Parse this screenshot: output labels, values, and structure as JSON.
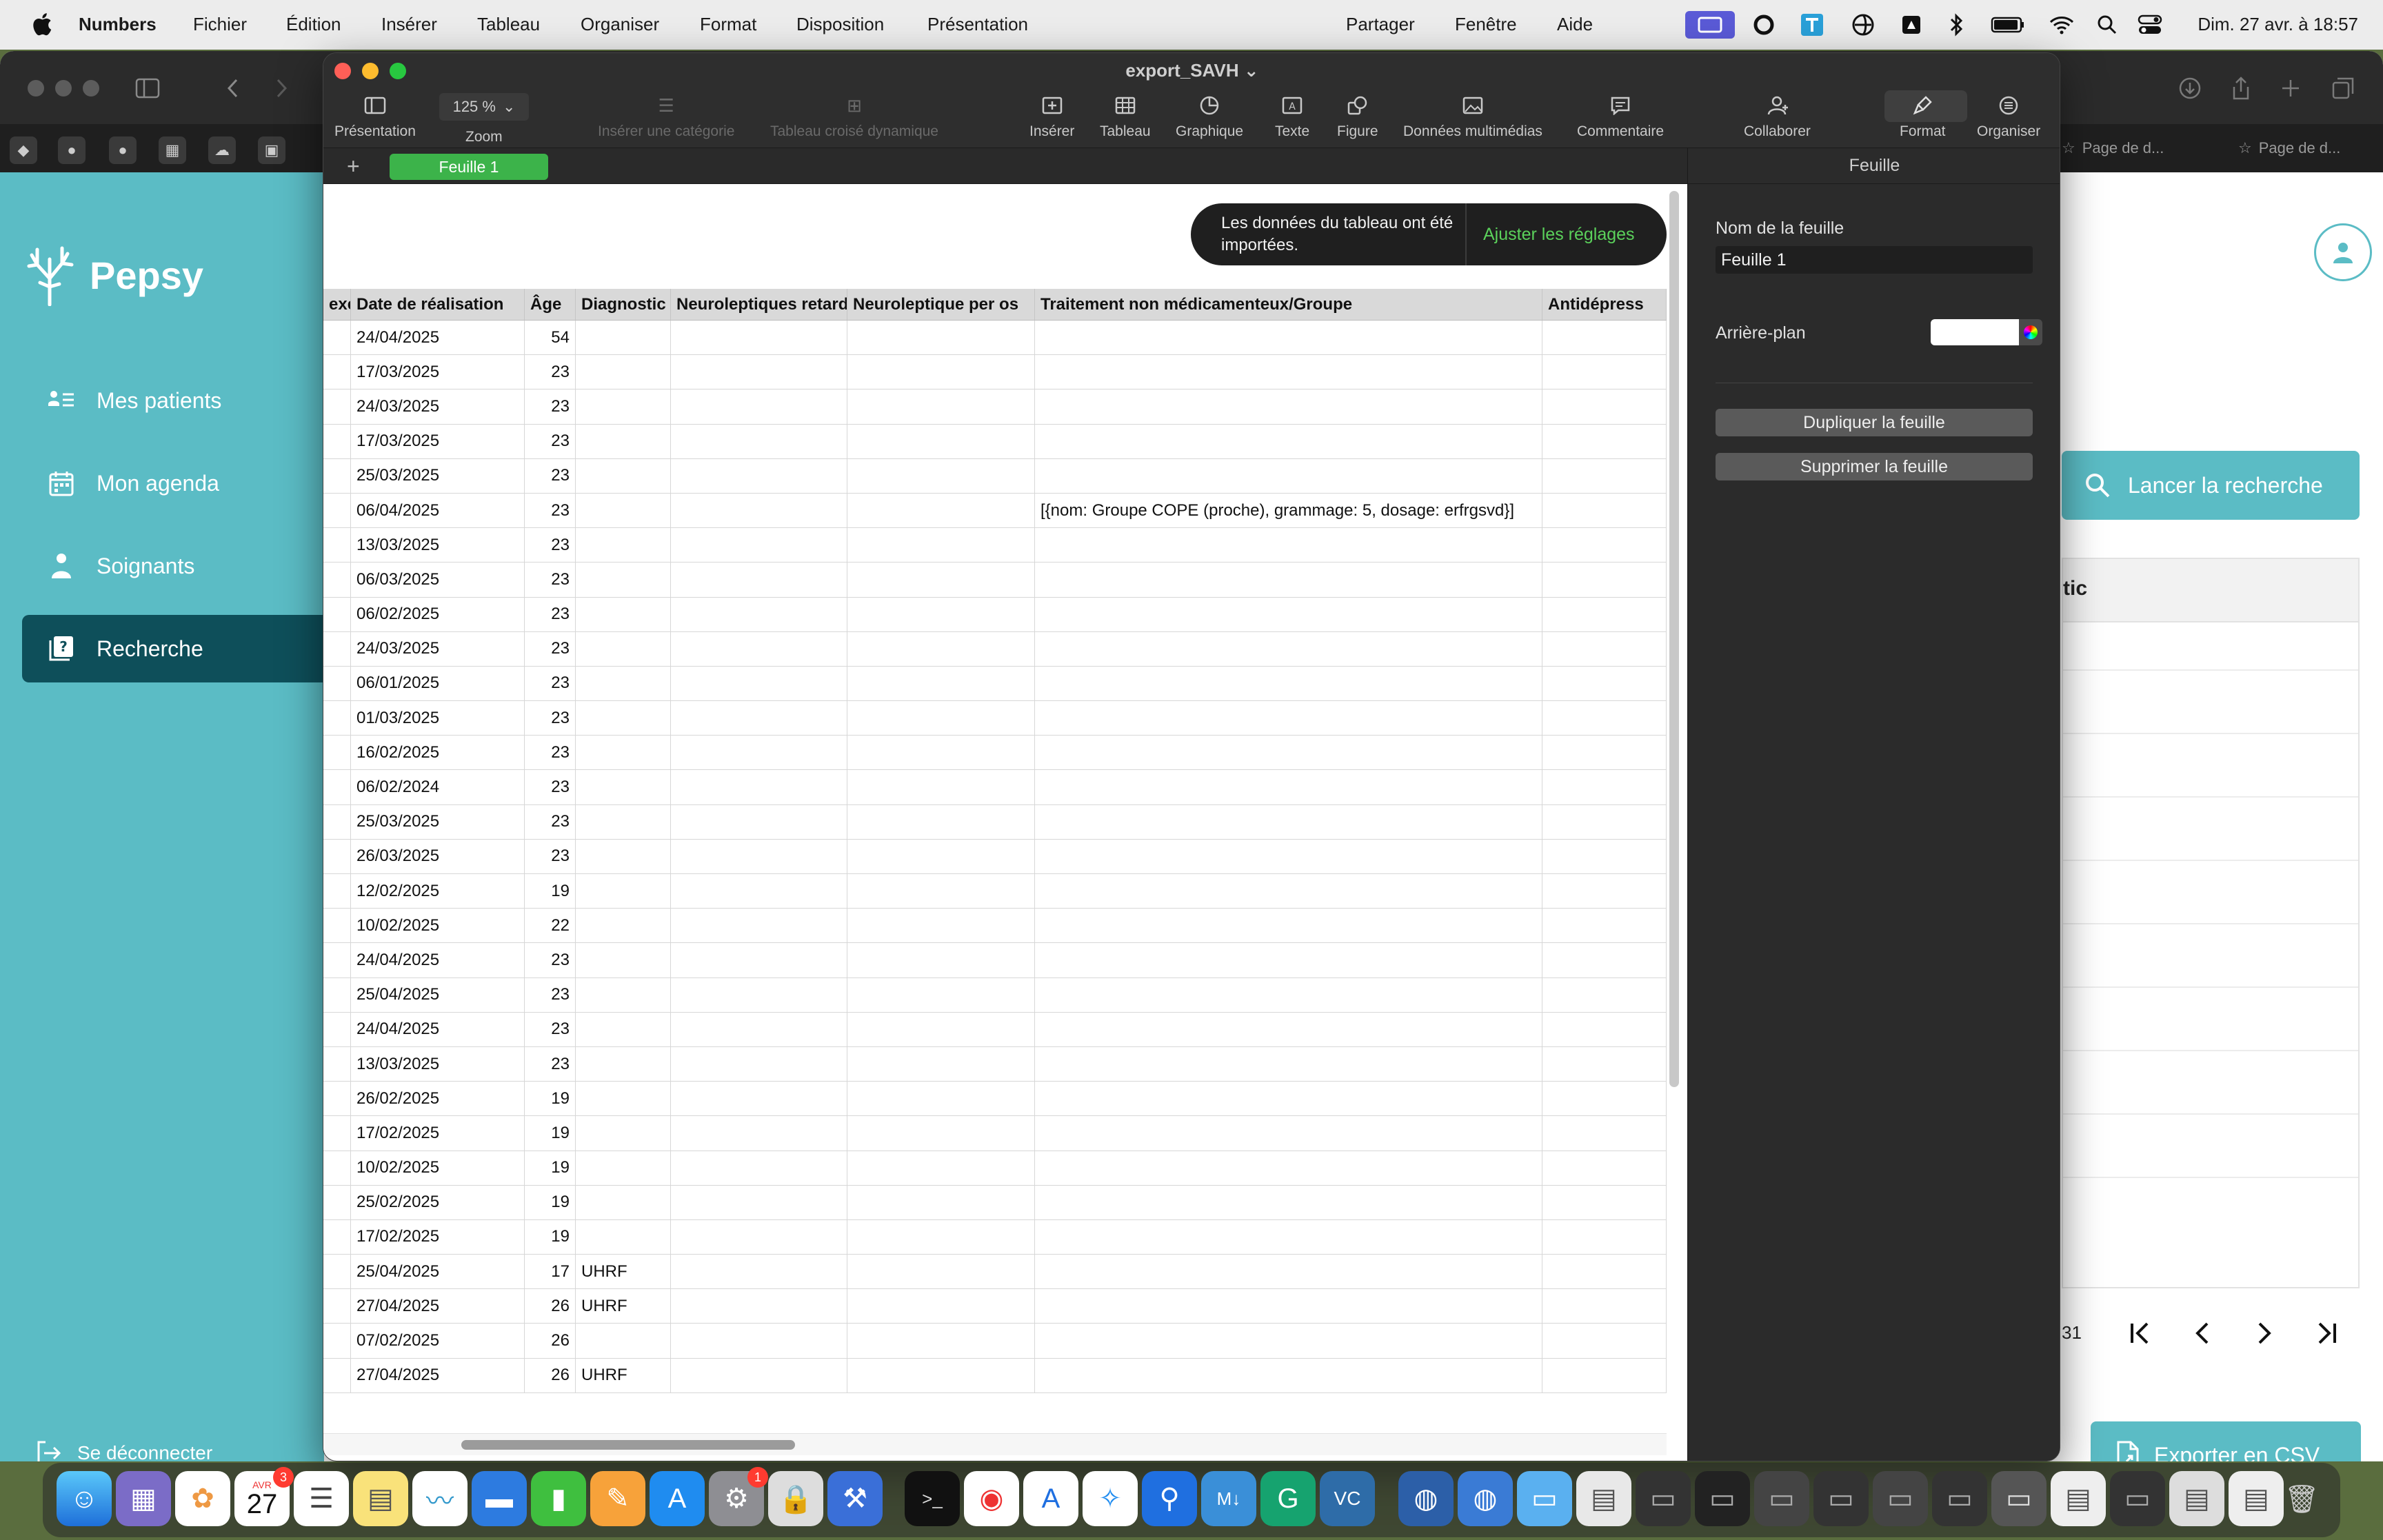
{
  "menubar": {
    "app_name": "Numbers",
    "items": [
      "Fichier",
      "Édition",
      "Insérer",
      "Tableau",
      "Organiser",
      "Format",
      "Disposition",
      "Présentation"
    ],
    "right_items": [
      "Partager",
      "Fenêtre",
      "Aide"
    ],
    "clock": "Dim. 27 avr. à 18:57",
    "status_icons": [
      "display-icon",
      "grammarly-icon",
      "text-icon",
      "vpn-icon",
      "drive-icon",
      "bluetooth-icon",
      "battery-icon",
      "wifi-icon",
      "search-icon",
      "control-center-icon"
    ]
  },
  "browser": {
    "tabs": [
      "Page de d...",
      "Page de d..."
    ]
  },
  "pepsy": {
    "logo": "Pepsy",
    "nav": [
      "Mes patients",
      "Mon agenda",
      "Soignants",
      "Recherche"
    ],
    "active_nav": "Recherche",
    "logout": "Se déconnecter",
    "search_button": "Lancer la recherche",
    "results_header_partial": "tic",
    "pager_partial": "31",
    "export_button": "Exporter en CSV"
  },
  "numbers": {
    "document_title": "export_SAVH",
    "zoom": "125 %",
    "toolbar": {
      "presentation": "Présentation",
      "zoom": "Zoom",
      "insert_category": "Insérer une catégorie",
      "pivot": "Tableau croisé dynamique",
      "insert": "Insérer",
      "table": "Tableau",
      "chart": "Graphique",
      "text": "Texte",
      "shape": "Figure",
      "media": "Données multimédias",
      "comment": "Commentaire",
      "collaborate": "Collaborer",
      "format": "Format",
      "organize": "Organiser"
    },
    "sheet_tab": "Feuille 1",
    "toast": {
      "message": "Les données du tableau ont été importées.",
      "action": "Ajuster les réglages"
    },
    "table": {
      "headers": [
        "exe",
        "Date de réalisation",
        "Âge",
        "Diagnostic",
        "Neuroleptiques retard",
        "Neuroleptique per os",
        "Traitement non médicamenteux/Groupe",
        "Antidépress"
      ],
      "rows": [
        [
          "",
          "24/04/2025",
          "54",
          "",
          "",
          "",
          "",
          ""
        ],
        [
          "",
          "17/03/2025",
          "23",
          "",
          "",
          "",
          "",
          ""
        ],
        [
          "",
          "24/03/2025",
          "23",
          "",
          "",
          "",
          "",
          ""
        ],
        [
          "",
          "17/03/2025",
          "23",
          "",
          "",
          "",
          "",
          ""
        ],
        [
          "",
          "25/03/2025",
          "23",
          "",
          "",
          "",
          "",
          ""
        ],
        [
          "",
          "06/04/2025",
          "23",
          "",
          "",
          "",
          "[{nom: Groupe COPE (proche), grammage: 5, dosage: erfrgsvd}]",
          ""
        ],
        [
          "",
          "13/03/2025",
          "23",
          "",
          "",
          "",
          "",
          ""
        ],
        [
          "",
          "06/03/2025",
          "23",
          "",
          "",
          "",
          "",
          ""
        ],
        [
          "",
          "06/02/2025",
          "23",
          "",
          "",
          "",
          "",
          ""
        ],
        [
          "",
          "24/03/2025",
          "23",
          "",
          "",
          "",
          "",
          ""
        ],
        [
          "",
          "06/01/2025",
          "23",
          "",
          "",
          "",
          "",
          ""
        ],
        [
          "",
          "01/03/2025",
          "23",
          "",
          "",
          "",
          "",
          ""
        ],
        [
          "",
          "16/02/2025",
          "23",
          "",
          "",
          "",
          "",
          ""
        ],
        [
          "",
          "06/02/2024",
          "23",
          "",
          "",
          "",
          "",
          ""
        ],
        [
          "",
          "25/03/2025",
          "23",
          "",
          "",
          "",
          "",
          ""
        ],
        [
          "",
          "26/03/2025",
          "23",
          "",
          "",
          "",
          "",
          ""
        ],
        [
          "",
          "12/02/2025",
          "19",
          "",
          "",
          "",
          "",
          ""
        ],
        [
          "",
          "10/02/2025",
          "22",
          "",
          "",
          "",
          "",
          ""
        ],
        [
          "",
          "24/04/2025",
          "23",
          "",
          "",
          "",
          "",
          ""
        ],
        [
          "",
          "25/04/2025",
          "23",
          "",
          "",
          "",
          "",
          ""
        ],
        [
          "",
          "24/04/2025",
          "23",
          "",
          "",
          "",
          "",
          ""
        ],
        [
          "",
          "13/03/2025",
          "23",
          "",
          "",
          "",
          "",
          ""
        ],
        [
          "",
          "26/02/2025",
          "19",
          "",
          "",
          "",
          "",
          ""
        ],
        [
          "",
          "17/02/2025",
          "19",
          "",
          "",
          "",
          "",
          ""
        ],
        [
          "",
          "10/02/2025",
          "19",
          "",
          "",
          "",
          "",
          ""
        ],
        [
          "",
          "25/02/2025",
          "19",
          "",
          "",
          "",
          "",
          ""
        ],
        [
          "",
          "17/02/2025",
          "19",
          "",
          "",
          "",
          "",
          ""
        ],
        [
          "",
          "25/04/2025",
          "17",
          "UHRF",
          "",
          "",
          "",
          ""
        ],
        [
          "",
          "27/04/2025",
          "26",
          "UHRF",
          "",
          "",
          "",
          ""
        ],
        [
          "",
          "07/02/2025",
          "26",
          "",
          "",
          "",
          "",
          ""
        ],
        [
          "",
          "27/04/2025",
          "26",
          "UHRF",
          "",
          "",
          "",
          ""
        ]
      ]
    },
    "inspector": {
      "title": "Feuille",
      "sheet_name_label": "Nom de la feuille",
      "sheet_name_value": "Feuille 1",
      "background_label": "Arrière-plan",
      "duplicate": "Dupliquer la feuille",
      "delete": "Supprimer la feuille"
    }
  },
  "dock": {
    "calendar_month": "AVR",
    "calendar_day": "27",
    "calendar_badge": "3",
    "settings_badge": "1"
  }
}
